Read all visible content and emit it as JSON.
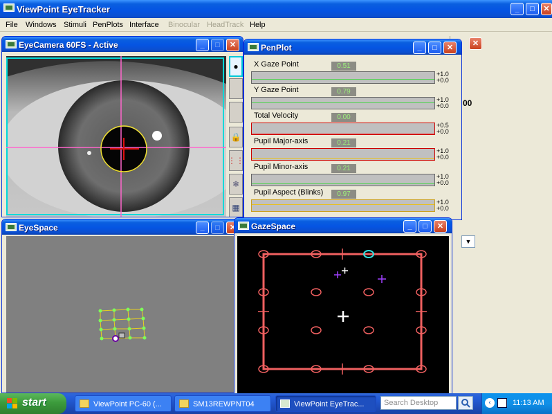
{
  "app": {
    "title": "ViewPoint EyeTracker",
    "menu": [
      "File",
      "Windows",
      "Stimuli",
      "PenPlots",
      "Interface",
      "Binocular",
      "HeadTrack",
      "Help"
    ]
  },
  "eye_camera": {
    "title": "EyeCamera 60FS - Active"
  },
  "penplot": {
    "title": "PenPlot",
    "rows": [
      {
        "label": "X Gaze Point",
        "value": "0.51",
        "scale_top": "+1.0",
        "scale_bottom": "+0.0"
      },
      {
        "label": "Y Gaze Point",
        "value": "0.79",
        "scale_top": "+1.0",
        "scale_bottom": "+0.0"
      },
      {
        "label": "Total Velocity",
        "value": "0.00",
        "scale_top": "+0.5",
        "scale_bottom": "+0.0"
      },
      {
        "label": "Pupil Major-axis",
        "value": "0.21",
        "scale_top": "+1.0",
        "scale_bottom": "+0.0"
      },
      {
        "label": "Pupil Minor-axis",
        "value": "0.21",
        "scale_top": "+1.0",
        "scale_bottom": "+0.0"
      },
      {
        "label": "Pupil Aspect (Blinks)",
        "value": "0.97",
        "scale_top": "+1.0",
        "scale_bottom": "+0.0"
      }
    ]
  },
  "eyespace": {
    "title": "EyeSpace"
  },
  "gazespace": {
    "title": "GazeSpace"
  },
  "background": {
    "partial_text": "00"
  },
  "taskbar": {
    "start": "start",
    "tasks": [
      {
        "label": "ViewPoint PC-60 (..."
      },
      {
        "label": "SM13REWPNT04"
      },
      {
        "label": "ViewPoint EyeTrac..."
      }
    ],
    "search_placeholder": "Search Desktop",
    "clock": "11:13 AM"
  },
  "colors": {
    "accent": "#0a5fe0",
    "grid": "#f06060",
    "values": "#9cf07a"
  }
}
